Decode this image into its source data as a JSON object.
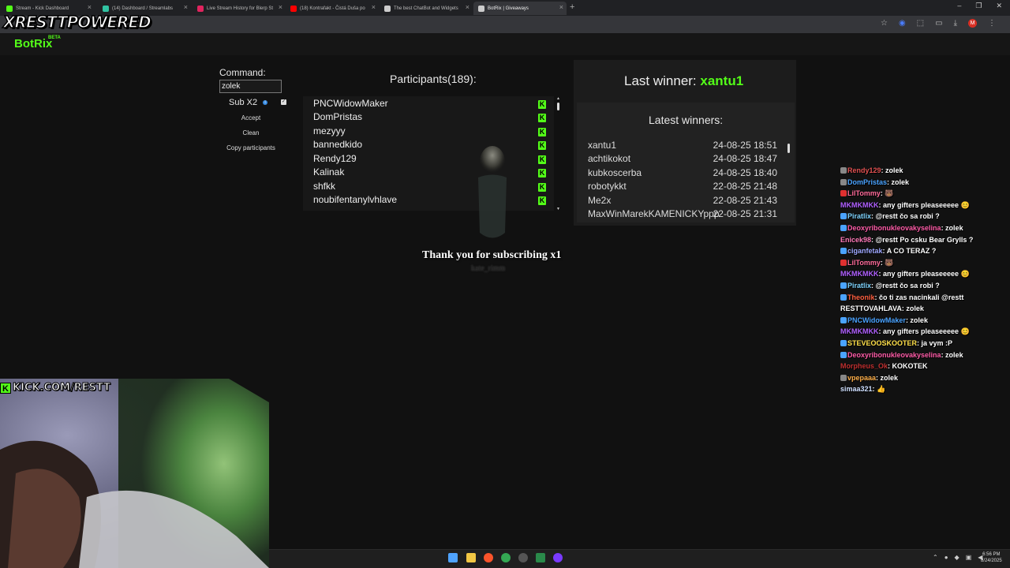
{
  "browser": {
    "tabs": [
      {
        "label": "Stream - Kick Dashboard",
        "color": "#53fc18"
      },
      {
        "label": "(14) Dashboard / Streamlabs",
        "color": "#31c3a2"
      },
      {
        "label": "Live Stream History for Blerp St",
        "color": "#e0245e"
      },
      {
        "label": "(18) Kontrafakt - Čistá Duša po",
        "color": "#ff0000"
      },
      {
        "label": "The best ChatBot and Widgets",
        "color": "#cccccc"
      },
      {
        "label": "BotRix | Giveaways",
        "color": "#cccccc"
      }
    ],
    "new_tab": "+",
    "minimize": "–",
    "maximize": "❐",
    "close": "✕",
    "profile_initial": "M"
  },
  "overlay": {
    "brand": "XRESTTPOWERED",
    "kick_url": "KICK.COM/RESTT",
    "kick_letter": "K"
  },
  "app": {
    "logo": "BotRix",
    "beta": "BETA"
  },
  "command_panel": {
    "label": "Command:",
    "input_value": "zolek",
    "sub_label": "Sub X2",
    "info": "i",
    "check": "✓",
    "accept": "Accept",
    "clean": "Clean",
    "copy": "Copy participants"
  },
  "participants": {
    "title": "Participants(189):",
    "items": [
      "PNCWidowMaker",
      "DomPristas",
      "mezyyy",
      "bannedkido",
      "Rendy129",
      "Kalinak",
      "shfkk",
      "noubifentanylvhlave"
    ],
    "badge": "K"
  },
  "winners": {
    "last_prefix": "Last winner: ",
    "last_name": "xantu1",
    "latest_title": "Latest winners:",
    "items": [
      {
        "name": "xantu1",
        "date": "24-08-25 18:51"
      },
      {
        "name": "achtikokot",
        "date": "24-08-25 18:47"
      },
      {
        "name": "kubkoscerba",
        "date": "24-08-25 18:40"
      },
      {
        "name": "robotykkt",
        "date": "22-08-25 21:48"
      },
      {
        "name": "Me2x",
        "date": "22-08-25 21:43"
      },
      {
        "name": "MaxWinMarekKAMENICKYppp",
        "date": "22-08-25 21:31"
      }
    ]
  },
  "alert": {
    "text": "Thank you for subscribing x1",
    "user": "kate_rimm"
  },
  "chat": [
    {
      "user": "Rendy129",
      "color": "#e05050",
      "msg": ": zolek",
      "badge": "#888888"
    },
    {
      "user": "DomPristas",
      "color": "#4aa3ff",
      "msg": ": zolek",
      "badge": "#888888"
    },
    {
      "user": "LilTommy",
      "color": "#ff6b9a",
      "msg": ": 🐻",
      "badge": "#e03030"
    },
    {
      "user": "MKMKMKK",
      "color": "#b060ff",
      "msg": ": any gifters pleaseeeee 😊",
      "badge": ""
    },
    {
      "user": "Piratlix",
      "color": "#7fd4ff",
      "msg": ": @restt čo sa robi ?",
      "badge": "#4aa3ff"
    },
    {
      "user": "Deoxyribonukleovakyselina",
      "color": "#ff5ca8",
      "msg": ": zolek",
      "badge": "#4aa3ff"
    },
    {
      "user": "Enicek98",
      "color": "#ff7ab8",
      "msg": ": @restt Po csku Bear Grylls ?",
      "badge": ""
    },
    {
      "user": "ciganfetak",
      "color": "#9fa8ff",
      "msg": ": A CO TERAZ ?",
      "badge": "#4aa3ff"
    },
    {
      "user": "LilTommy",
      "color": "#ff6b9a",
      "msg": ": 🐻",
      "badge": "#e03030"
    },
    {
      "user": "MKMKMKK",
      "color": "#b060ff",
      "msg": ": any gifters pleaseeeee 😊",
      "badge": ""
    },
    {
      "user": "Piratlix",
      "color": "#7fd4ff",
      "msg": ": @restt čo sa robi ?",
      "badge": "#4aa3ff"
    },
    {
      "user": "Theonik",
      "color": "#ff6040",
      "msg": ": čo ti zas nacinkali @restt",
      "badge": "#4aa3ff"
    },
    {
      "user": "RESTTOVAHLAVA",
      "color": "#ffffff",
      "msg": ": zolek",
      "badge": ""
    },
    {
      "user": "PNCWidowMaker",
      "color": "#4aa3ff",
      "msg": ": zolek",
      "badge": "#4aa3ff"
    },
    {
      "user": "MKMKMKK",
      "color": "#b060ff",
      "msg": ": any gifters pleaseeeee 😊",
      "badge": ""
    },
    {
      "user": "STEVEOOSKOOTER",
      "color": "#ffe04a",
      "msg": ": ja vym :P",
      "badge": "#4aa3ff"
    },
    {
      "user": "Deoxyribonukleovakyselina",
      "color": "#ff5ca8",
      "msg": ": zolek",
      "badge": "#4aa3ff"
    },
    {
      "user": "Morpheus_Ok",
      "color": "#c03030",
      "msg": ": KOKOTEK",
      "badge": ""
    },
    {
      "user": "vpepaaa",
      "color": "#ffb04a",
      "msg": ": zolek",
      "badge": "#888888"
    },
    {
      "user": "simaa321",
      "color": "#cfe0ff",
      "msg": ": 👍",
      "badge": ""
    }
  ],
  "taskbar": {
    "time": "6:56 PM",
    "date": "8/24/2025"
  }
}
